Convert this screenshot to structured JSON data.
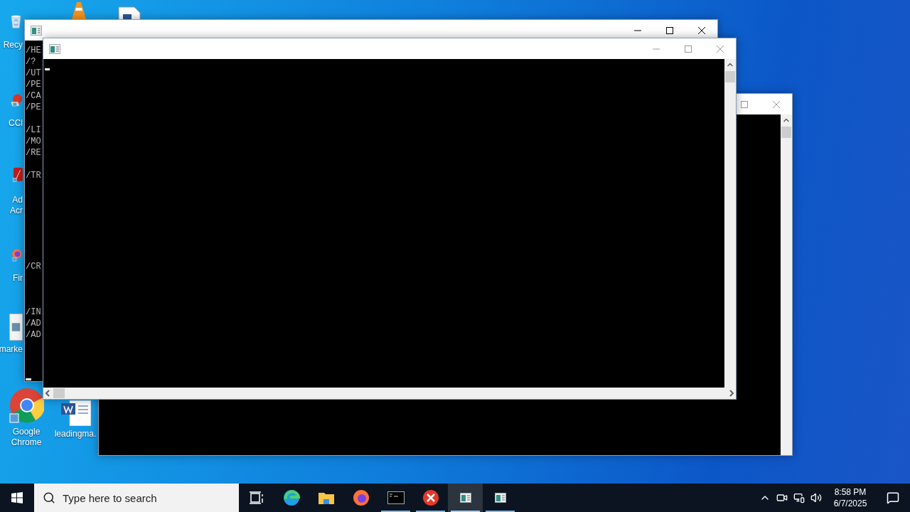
{
  "desktop_icons": [
    {
      "kind": "recycle",
      "lines": [
        "Recy"
      ]
    },
    {
      "kind": "cone"
    },
    {
      "kind": "document"
    },
    {
      "kind": "cleaner",
      "lines": [
        "CCl"
      ]
    },
    {
      "kind": "acrobat",
      "lines": [
        "Ad",
        "Acr"
      ]
    },
    {
      "kind": "firefox",
      "lines": [
        "Fir"
      ]
    },
    {
      "kind": "image",
      "lines": [
        "marke"
      ]
    },
    {
      "kind": "chrome",
      "lines": [
        "Google",
        "Chrome"
      ]
    },
    {
      "kind": "word",
      "lines": [
        "leadingma."
      ]
    }
  ],
  "windows": [
    {
      "focused": false,
      "buttons": [
        {
          "kind": "maximize"
        },
        {
          "kind": "close"
        }
      ]
    },
    {
      "focused": true,
      "buttons": [
        {
          "kind": "minimize"
        },
        {
          "kind": "maximize"
        },
        {
          "kind": "close"
        }
      ],
      "blocks": [
        [
          "/HE",
          "/?",
          "/UT",
          "/PE",
          "/CA",
          "/PE"
        ],
        [
          "/LI",
          "/MO",
          "/RE"
        ],
        [
          "/TR"
        ],
        [
          "/CR"
        ],
        [
          "/IN",
          "/AD",
          "/AD"
        ]
      ]
    },
    {
      "focused": false,
      "buttons": [
        {
          "kind": "minimize"
        },
        {
          "kind": "maximize"
        },
        {
          "kind": "close"
        }
      ]
    }
  ],
  "taskbar": {
    "search": {
      "placeholder": "Type here to search"
    },
    "apps": [
      {
        "kind": "taskview",
        "running": false,
        "selected": false
      },
      {
        "kind": "edge",
        "running": false,
        "selected": false
      },
      {
        "kind": "folder",
        "running": false,
        "selected": false
      },
      {
        "kind": "firefox",
        "running": false,
        "selected": false
      },
      {
        "kind": "terminal",
        "running": true,
        "selected": false
      },
      {
        "kind": "error",
        "running": true,
        "selected": false
      },
      {
        "kind": "console",
        "running": true,
        "selected": true
      },
      {
        "kind": "console",
        "running": true,
        "selected": false
      }
    ],
    "clock": {
      "time": "8:58 PM",
      "date": "6/7/2025"
    }
  }
}
